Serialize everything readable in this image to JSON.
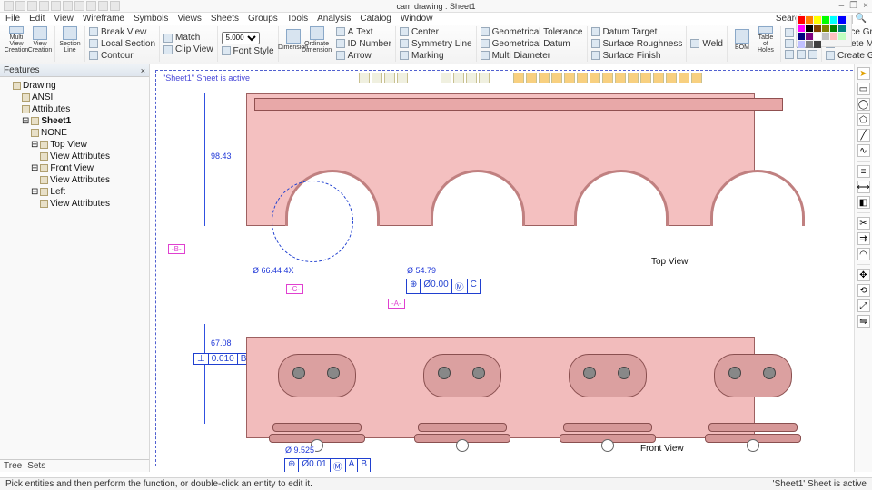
{
  "app": {
    "doc_title": "cam drawing : Sheet1"
  },
  "win": {
    "min": "–",
    "max": "❐",
    "close": "×"
  },
  "menu": [
    "File",
    "Edit",
    "View",
    "Wireframe",
    "Symbols",
    "Views",
    "Sheets",
    "Groups",
    "Tools",
    "Analysis",
    "Catalog",
    "Window"
  ],
  "search": {
    "label": "Search",
    "placeholder": ""
  },
  "ribbon": {
    "multiview": "Multi View\nCreation",
    "viewcreation": "View\nCreation",
    "sectionline": "Section Line",
    "breakview": "Break View",
    "localsection": "Local Section",
    "contour": "Contour",
    "match": "Match",
    "clipview": "Clip View",
    "fontsize": "5.000",
    "fontstyle": "Font Style",
    "dimension": "Dimension",
    "ordinate": "Ordinate\nDimension",
    "itext": "Text",
    "idnumber": "ID Number",
    "arrow": "Arrow",
    "center": "Center",
    "symline": "Symmetry Line",
    "marking": "Marking",
    "geotol": "Geometrical Tolerance",
    "geodat": "Geometrical Datum",
    "multidia": "Multi Diameter",
    "datumtgt": "Datum Target",
    "surfrough": "Surface Roughness",
    "surffinish": "Surface Finish",
    "weld": "Weld",
    "bom": "BOM",
    "tableholes": "Table of\nHoles",
    "placegroup": "Place Group",
    "delmaster": "Delete Master Group",
    "creategroup": "Create Group"
  },
  "features": {
    "title": "Features",
    "tree": {
      "root": "Drawing",
      "ansi": "ANSI",
      "attributes": "Attributes",
      "sheet": "Sheet1",
      "none": "NONE",
      "topview": "Top View",
      "viewattr": "View Attributes",
      "frontview": "Front View",
      "left": "Left"
    },
    "tabs": [
      "Tree",
      "Sets"
    ]
  },
  "sheet": {
    "active_msg": "\"Sheet1\" Sheet is active",
    "topview_label": "Top View",
    "frontview_label": "Front View",
    "dim_9843": "98.43",
    "dim_6708": "67.08",
    "dim_66": "Ø 66.44 4X",
    "dim_54": "Ø 54.79",
    "dim_9525": "Ø 9.525",
    "datum_a": "-A-",
    "datum_b": "-B-",
    "datum_c": "-C-",
    "fcf_top": {
      "sym": "⊕",
      "tol": "Ø0.00",
      "mod": "Ⓜ",
      "ref": "C"
    },
    "fcf_perp": {
      "sym": "⊥",
      "tol": "0.010",
      "ref": "B"
    },
    "fcf_bot": {
      "sym": "⊕",
      "tol": "Ø0.01",
      "mod": "Ⓜ",
      "ref1": "A",
      "ref2": "B"
    }
  },
  "palette_colors": [
    "#ff0000",
    "#ff8000",
    "#ffff00",
    "#00ff00",
    "#00ffff",
    "#0000ff",
    "#ff00ff",
    "#000000",
    "#804000",
    "#808000",
    "#008000",
    "#008080",
    "#000080",
    "#800080",
    "#ffffff",
    "#c0c0c0",
    "#ffc0c0",
    "#c0ffc0",
    "#c0c0ff",
    "#808080",
    "#404040"
  ],
  "status": {
    "hint": "Pick entities and then perform the function, or double-click an entity to edit it.",
    "right": "'Sheet1' Sheet is active"
  }
}
